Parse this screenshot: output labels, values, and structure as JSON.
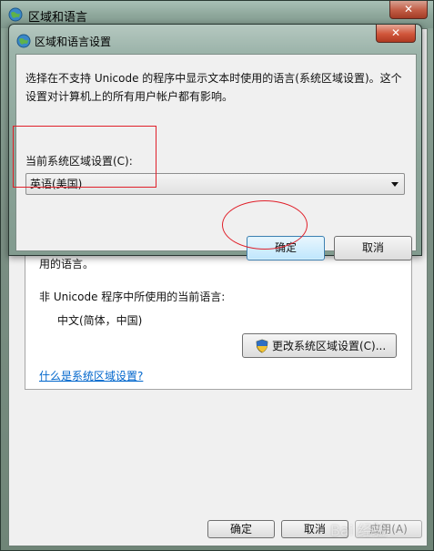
{
  "outer_window": {
    "title": "区域和语言",
    "close_label": "✕",
    "partial_text": "用的语言。",
    "current_language_label": "非 Unicode 程序中所使用的当前语言:",
    "current_language_value": "中文(简体，中国)",
    "change_button_label": "更改系统区域设置(C)...",
    "what_is_link": "什么是系统区域设置?",
    "buttons": {
      "ok": "确定",
      "cancel": "取消",
      "apply": "应用(A)"
    }
  },
  "dialog": {
    "title": "区域和语言设置",
    "close_label": "✕",
    "description": "选择在不支持 Unicode 的程序中显示文本时使用的语言(系统区域设置)。这个设置对计算机上的所有用户帐户都有影响。",
    "locale_label": "当前系统区域设置(C):",
    "locale_value": "英语(美国)",
    "buttons": {
      "ok": "确定",
      "cancel": "取消"
    }
  },
  "watermark": "Bai 经验",
  "colors": {
    "annotation_red": "#e0202a",
    "link_blue": "#0066cc",
    "default_button_border": "#3c7fb1"
  },
  "icons": [
    "globe-icon",
    "close-icon",
    "shield-icon",
    "chevron-down-icon"
  ]
}
